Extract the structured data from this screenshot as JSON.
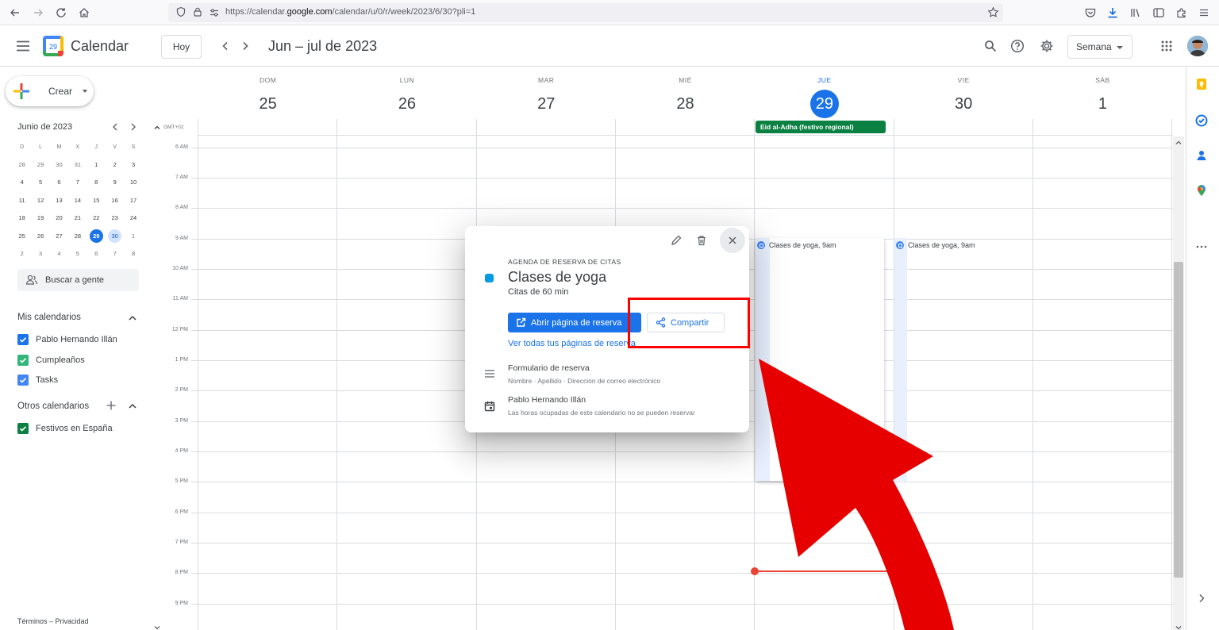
{
  "browser": {
    "url_prefix": "https://calendar.",
    "url_domain": "google.com",
    "url_path": "/calendar/u/0/r/week/2023/6/30?pli=1"
  },
  "header": {
    "app_title": "Calendar",
    "logo_day": "29",
    "today_label": "Hoy",
    "date_range": "Jun – jul de 2023",
    "view_label": "Semana"
  },
  "sidebar": {
    "create_label": "Crear",
    "mini_month": "Junio de 2023",
    "mini_dow": [
      "D",
      "L",
      "M",
      "X",
      "J",
      "V",
      "S"
    ],
    "mini_weeks": [
      [
        "28",
        "29",
        "30",
        "31",
        "1",
        "2",
        "3"
      ],
      [
        "4",
        "5",
        "6",
        "7",
        "8",
        "9",
        "10"
      ],
      [
        "11",
        "12",
        "13",
        "14",
        "15",
        "16",
        "17"
      ],
      [
        "18",
        "19",
        "20",
        "21",
        "22",
        "23",
        "24"
      ],
      [
        "25",
        "26",
        "27",
        "28",
        "29",
        "30",
        "1"
      ],
      [
        "2",
        "3",
        "4",
        "5",
        "6",
        "7",
        "8"
      ]
    ],
    "search_people": "Buscar a gente",
    "my_calendars_title": "Mis calendarios",
    "my_calendars": [
      {
        "label": "Pablo Hernando Illán",
        "color": "#1a73e8"
      },
      {
        "label": "Cumpleaños",
        "color": "#33b679"
      },
      {
        "label": "Tasks",
        "color": "#4285f4"
      }
    ],
    "other_calendars_title": "Otros calendarios",
    "other_calendars": [
      {
        "label": "Festivos en España",
        "color": "#0b8043"
      }
    ],
    "footer": "Términos – Privacidad"
  },
  "week": {
    "timezone": "GMT+02",
    "days": [
      {
        "dow": "DOM",
        "date": "25"
      },
      {
        "dow": "LUN",
        "date": "26"
      },
      {
        "dow": "MAR",
        "date": "27"
      },
      {
        "dow": "MIÉ",
        "date": "28"
      },
      {
        "dow": "JUE",
        "date": "29",
        "today": true
      },
      {
        "dow": "VIE",
        "date": "30"
      },
      {
        "dow": "SÁB",
        "date": "1"
      }
    ],
    "hours": [
      "6 AM",
      "7 AM",
      "8 AM",
      "9 AM",
      "10 AM",
      "11 AM",
      "12 PM",
      "1 PM",
      "2 PM",
      "3 PM",
      "4 PM",
      "5 PM",
      "6 PM",
      "7 PM",
      "8 PM",
      "9 PM"
    ],
    "allday_event": "Eid al-Adha (festivo regional)",
    "booking_thu": "Clases de yoga, 9am",
    "booking_fri": "Clases de yoga, 9am"
  },
  "popover": {
    "kicker": "AGENDA DE RESERVA DE CITAS",
    "title": "Clases de yoga",
    "subtitle": "Citas de 60 min",
    "open_button": "Abrir página de reserva",
    "share_button": "Compartir",
    "view_all_link": "Ver todas tus páginas de reserva",
    "form_title": "Formulario de reserva",
    "form_fields": "Nombre · Apellido · Dirección de correo electrónico",
    "owner_title": "Pablo Hernando Illán",
    "owner_note": "Las horas ocupadas de este calendario no se pueden reservar"
  },
  "colors": {
    "accent": "#1a73e8",
    "event": "#039be5",
    "holiday": "#0b8043",
    "now_line": "#ea4335",
    "annotation": "#ff0000"
  }
}
